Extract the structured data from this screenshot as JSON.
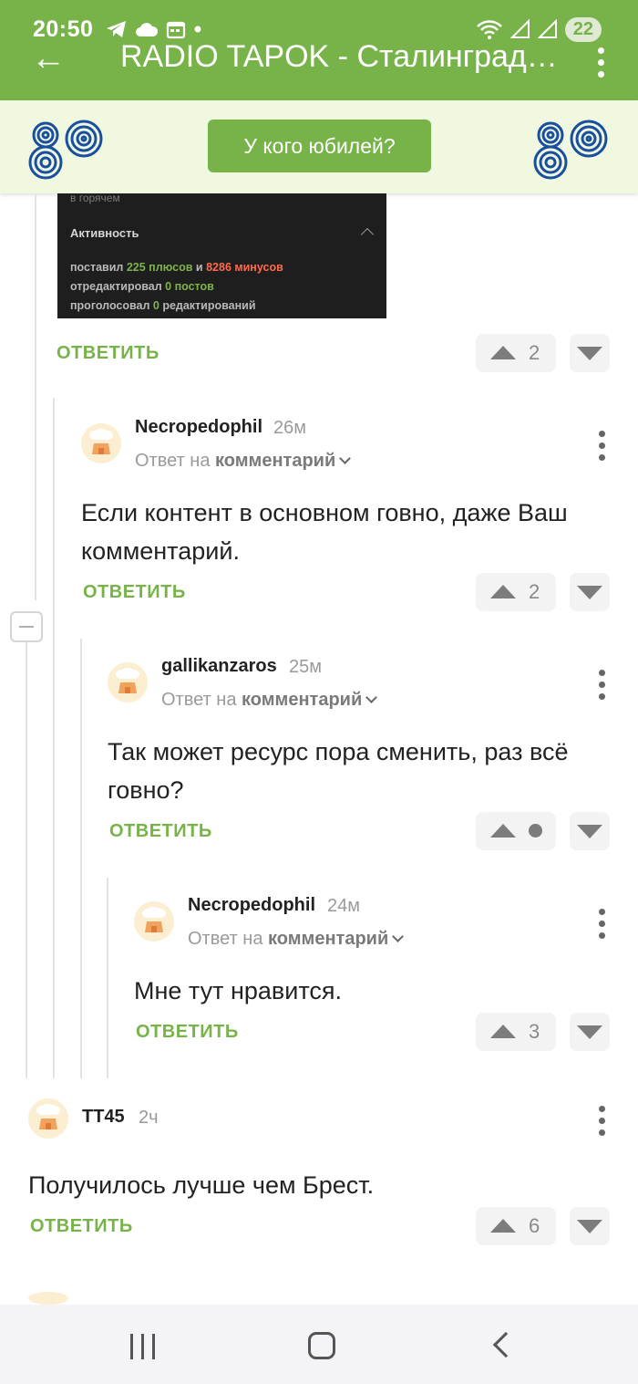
{
  "status_bar": {
    "time": "20:50",
    "battery": "22"
  },
  "app_bar": {
    "title": "RADIO TAPOK - Сталинград…"
  },
  "banner": {
    "button_label": "У кого юбилей?",
    "logo_text": "80"
  },
  "embedded_screenshot": {
    "top_text": "в горячем",
    "section_title": "Активность",
    "line1": {
      "a": "поставил ",
      "plus": "225 плюсов",
      "b": " и ",
      "minus": "8286 минусов"
    },
    "line2": {
      "a": "отредактировал ",
      "posts": "0 постов"
    },
    "line3": {
      "a": "проголосовал ",
      "edits": "0",
      "b": " редактирований"
    }
  },
  "colors": {
    "accent": "#78b34a",
    "banner_bg": "#f0f9e0",
    "text": "#222222",
    "muted": "#9a9a9a"
  },
  "icons": {
    "back": "arrow-left-icon",
    "more": "more-vertical-icon",
    "upvote": "triangle-up-icon",
    "downvote": "triangle-down-icon",
    "collapse": "minus-icon"
  },
  "reply_label": "ОТВЕТИТЬ",
  "reply_to_prefix": "Ответ на",
  "reply_to_target": "комментарий",
  "comments": [
    {
      "score": "2"
    },
    {
      "user": "Necropedophil",
      "time": "26м",
      "text": "Если контент в основном говно, даже Ваш комментарий.",
      "score": "2"
    },
    {
      "user": "gallikanzaros",
      "time": "25м",
      "text": "Так может ресурс пора сменить, раз всё говно?",
      "score": ""
    },
    {
      "user": "Necropedophil",
      "time": "24м",
      "text": "Мне тут нравится.",
      "score": "3"
    },
    {
      "user": "TT45",
      "time": "2ч",
      "text": "Получилось лучше чем Брест.",
      "score": "6"
    }
  ]
}
